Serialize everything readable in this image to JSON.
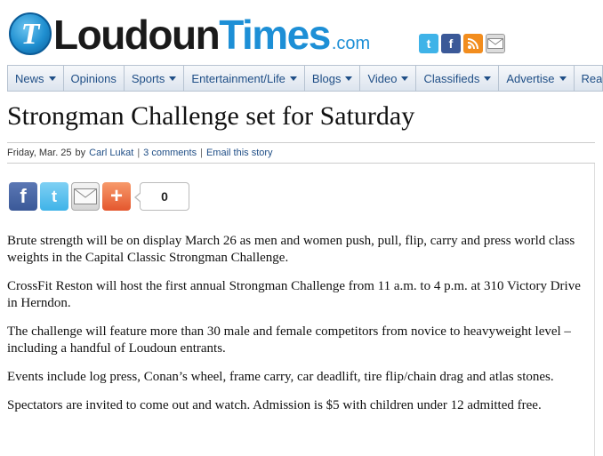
{
  "site": {
    "logo_letter": "T",
    "logo_word_1": "Loudoun",
    "logo_word_2": "Times",
    "logo_domain": ".com",
    "social_icons": [
      "twitter-icon",
      "facebook-icon",
      "rss-icon",
      "mail-icon"
    ]
  },
  "nav": {
    "items": [
      {
        "label": "News"
      },
      {
        "label": "Opinions"
      },
      {
        "label": "Sports"
      },
      {
        "label": "Entertainment/Life"
      },
      {
        "label": "Blogs"
      },
      {
        "label": "Video"
      },
      {
        "label": "Classifieds"
      },
      {
        "label": "Advertise"
      },
      {
        "label": "Real"
      }
    ]
  },
  "article": {
    "headline": "Strongman Challenge set for Saturday",
    "date": "Friday, Mar. 25",
    "by": "by",
    "author": "Carl Lukat",
    "comments": "3 comments",
    "email": "Email this story",
    "share_count": "0",
    "paragraphs": [
      "Brute strength will be on display March 26 as men and women push, pull, flip, carry and press world class weights in the Capital Classic Strongman Challenge.",
      "CrossFit Reston will host the first annual Strongman Challenge from 11 a.m. to 4 p.m. at 310 Victory Drive in Herndon.",
      "The challenge will feature more than 30 male and female competitors from novice to heavyweight level – including a handful of Loudoun entrants.",
      "Events include log press, Conan’s wheel, frame carry, car deadlift, tire flip/chain drag and atlas stones.",
      "Spectators are invited to come out and watch. Admission is $5 with children under 12 admitted free."
    ]
  },
  "colors": {
    "brand_blue": "#1d8fd6",
    "nav_link": "#1f4e86"
  }
}
